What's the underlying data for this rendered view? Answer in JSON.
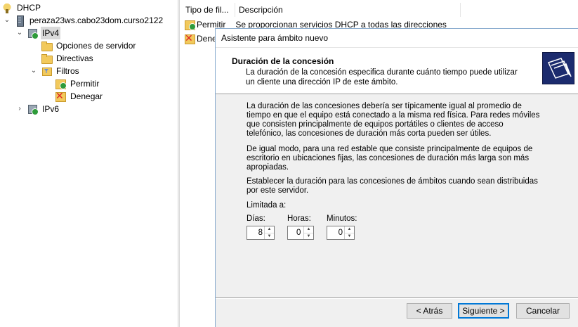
{
  "tree": {
    "root": "DHCP",
    "server": "peraza23ws.cabo23dom.curso2122",
    "ipv4": "IPv4",
    "server_options": "Opciones de servidor",
    "policies": "Directivas",
    "filters": "Filtros",
    "allow": "Permitir",
    "deny": "Denegar",
    "ipv6": "IPv6"
  },
  "list": {
    "columns": [
      "Tipo de fil...",
      "Descripción"
    ],
    "rows": [
      {
        "type": "Permitir",
        "description": "Se proporcionan servicios DHCP a todas las direcciones"
      },
      {
        "type": "Dene",
        "description": ""
      }
    ]
  },
  "wizard": {
    "window_title": "Asistente para ámbito nuevo",
    "header_title": "Duración de la concesión",
    "header_desc": "La duración de la concesión especifica durante cuánto tiempo puede utilizar un cliente una dirección IP de este ámbito.",
    "para1": "La duración de las concesiones debería ser típicamente igual al promedio de tiempo en que el equipo está conectado a la misma red física. Para redes móviles que consisten principalmente de equipos portátiles o clientes de acceso telefónico, las concesiones de duración más corta pueden ser útiles.",
    "para2": "De igual modo, para una red estable que consiste principalmente de equipos de escritorio en ubicaciones fijas, las concesiones de duración más larga son más apropiadas.",
    "para3": "Establecer la duración para las concesiones de ámbitos cuando sean distribuidas por este servidor.",
    "limit_label": "Limitada a:",
    "days_label": "Días:",
    "hours_label": "Horas:",
    "minutes_label": "Minutos:",
    "days_value": "8",
    "hours_value": "0",
    "minutes_value": "0",
    "back_button": "< Atrás",
    "next_button": "Siguiente >",
    "cancel_button": "Cancelar"
  }
}
